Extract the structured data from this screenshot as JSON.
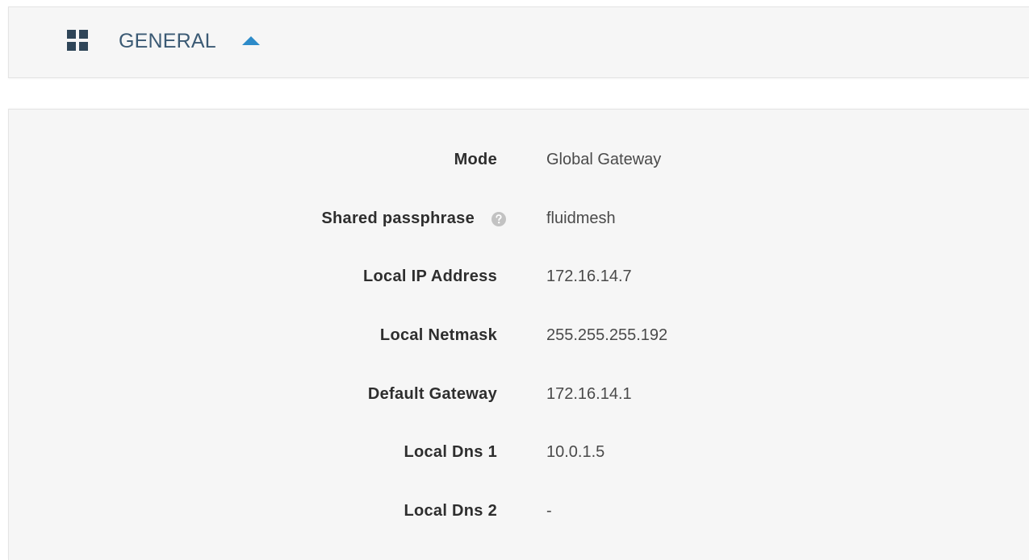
{
  "section": {
    "title": "GENERAL",
    "icon": "grid-icon",
    "toggle_icon": "caret-up-icon",
    "accent_color": "#2d8bc9"
  },
  "fields": [
    {
      "label": "Mode",
      "value": "Global Gateway"
    },
    {
      "label": "Shared passphrase",
      "value": "fluidmesh",
      "help_icon": "help-circle-icon"
    },
    {
      "label": "Local IP Address",
      "value": "172.16.14.7"
    },
    {
      "label": "Local Netmask",
      "value": "255.255.255.192"
    },
    {
      "label": "Default Gateway",
      "value": "172.16.14.1"
    },
    {
      "label": "Local Dns 1",
      "value": "10.0.1.5"
    },
    {
      "label": "Local Dns 2",
      "value": "-"
    }
  ]
}
